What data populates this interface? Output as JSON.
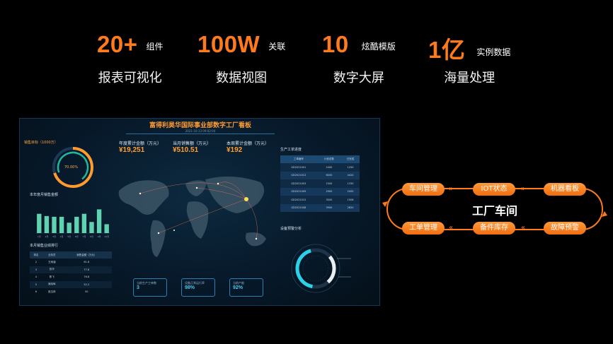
{
  "stats": [
    {
      "big": "20+",
      "small": "组件",
      "sub": "报表可视化"
    },
    {
      "big": "100W",
      "small": "关联",
      "sub": "数据视图"
    },
    {
      "big": "10",
      "small": "炫酷模版",
      "sub": "数字大屏"
    },
    {
      "big": "1亿",
      "small": "实例数据",
      "sub": "海量处理"
    }
  ],
  "dashboard": {
    "title": "富得利昊华国际事业部数字工厂看板",
    "date": "2021-10-13 09:02:04",
    "sales_target_label": "销售目标（1000万）",
    "gauge_value": "70.00%",
    "kpis": [
      {
        "label": "年度累计金额（万元）",
        "value": "¥19,251"
      },
      {
        "label": "当月销售额（万元）",
        "value": "¥510.51"
      },
      {
        "label": "本周累计金额（万元）",
        "value": "¥192"
      }
    ],
    "yearly_sales_label": "本年度月销售金额",
    "ranking_label": "本月销售业绩排行",
    "ranking": {
      "headers": [
        "排名",
        "业务员",
        "销售金额（万元）"
      ],
      "rows": [
        [
          "2",
          "王雨涵",
          "61.8"
        ],
        [
          "3",
          "张华",
          "77.6"
        ],
        [
          "4",
          "陈飞",
          "76.8"
        ],
        [
          "5",
          "吴晓晖",
          "52.2"
        ],
        [
          "6",
          "庞玉林",
          "50"
        ]
      ]
    },
    "production_label": "生产工单进度",
    "production": {
      "headers": [
        "工单编号",
        "计划总数",
        "已完成"
      ],
      "rows": [
        [
          "GD2021001",
          "2400",
          "1250"
        ],
        [
          "GD2021012",
          "6000",
          "4420"
        ],
        [
          "GD2021003",
          "1500",
          "1330"
        ],
        [
          "GD2021009",
          "2900",
          "2000"
        ],
        [
          "GD2021012",
          "3000",
          "1506"
        ],
        [
          "GD2021008",
          "3900",
          "2820"
        ]
      ]
    },
    "equipment_label": "设备预警分析",
    "metrics": [
      {
        "label": "当前生产工单数",
        "value": "3"
      },
      {
        "label": "设备正常运行率",
        "value": "98%"
      },
      {
        "label": "当前产能",
        "value": "92%"
      }
    ]
  },
  "chart_data": {
    "type": "bar",
    "title": "本年度月销售金额",
    "categories": [
      "1月",
      "2月",
      "3月",
      "4月",
      "5月",
      "6月",
      "7月",
      "8月",
      "9月",
      "10月"
    ],
    "values": [
      26,
      23,
      22,
      22,
      14,
      22,
      26,
      15,
      32,
      12
    ],
    "ylim": [
      0,
      40
    ]
  },
  "flow": {
    "center": "工厂车间",
    "top": [
      "车间管理",
      "IOT状态",
      "机器看板"
    ],
    "bottom": [
      "工单管理",
      "备件库存",
      "故障预警"
    ],
    "accent": "#ff7a1a"
  }
}
